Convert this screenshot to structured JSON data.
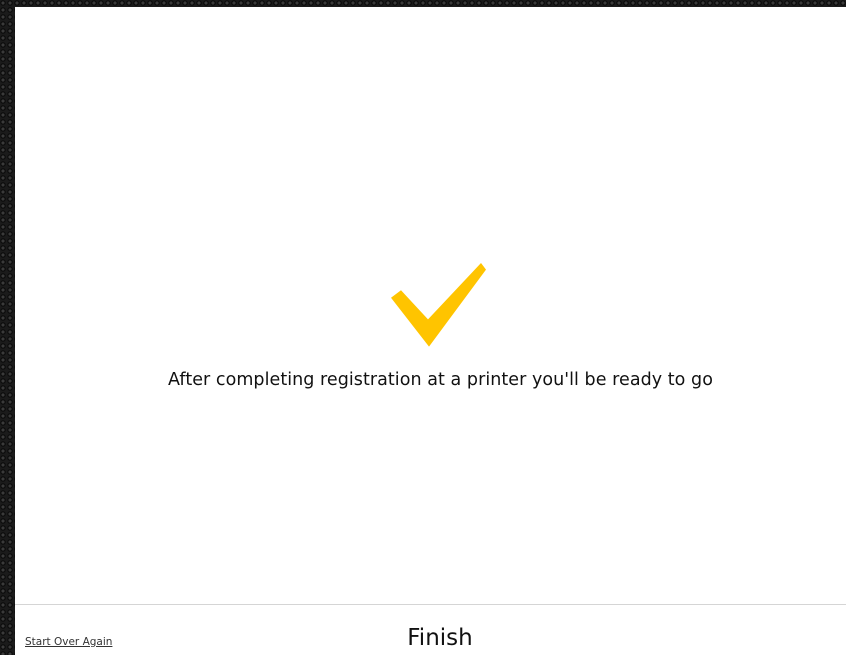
{
  "main": {
    "icon": "check-icon",
    "message": "After completing registration at a printer you'll be ready to go"
  },
  "footer": {
    "start_over_label": "Start Over Again",
    "finish_label": "Finish"
  },
  "colors": {
    "accent": "#FFC400",
    "background": "#FFFFFF",
    "text": "#111111"
  }
}
